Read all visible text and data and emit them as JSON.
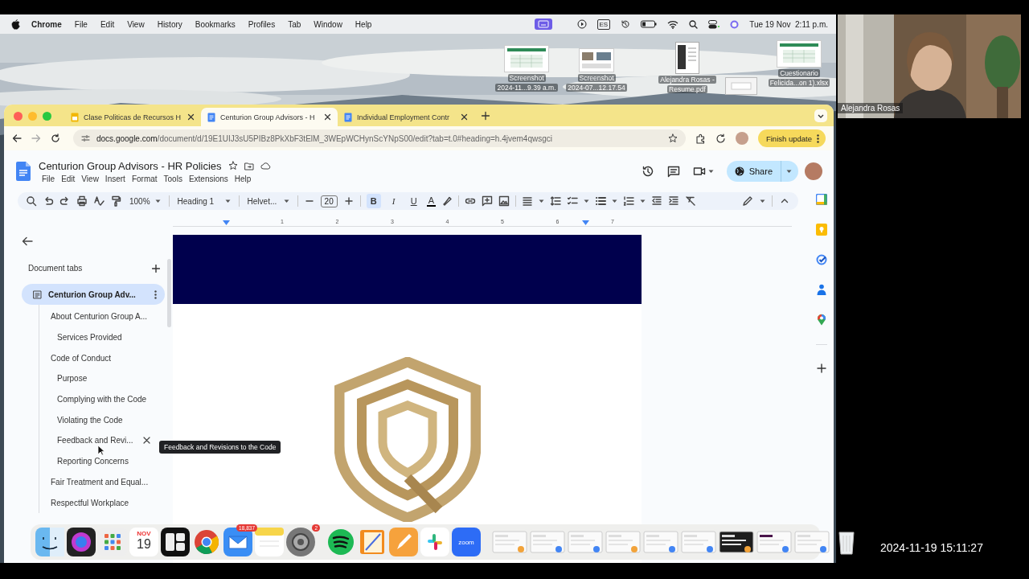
{
  "menubar": {
    "app": "Chrome",
    "menus": [
      "File",
      "Edit",
      "View",
      "History",
      "Bookmarks",
      "Profiles",
      "Tab",
      "Window",
      "Help"
    ],
    "input_source": "ES",
    "clock": "Tue 19 Nov  2:11 p.m."
  },
  "desktop_files": [
    {
      "kind": "sheet",
      "lines": [
        "Screenshot",
        "2024-11...9.39 a.m."
      ]
    },
    {
      "lines": [
        "Screenshot",
        "2024-07...12.17.54"
      ]
    },
    {
      "kind": "doc",
      "lines": [
        "Alejandra Rosas -",
        "Resume.pdf"
      ]
    },
    {
      "kind": "window"
    },
    {
      "kind": "sheet",
      "lines": [
        "Cuestionario",
        "Felicida...on 1).xlsx"
      ]
    }
  ],
  "browser": {
    "tabs": [
      {
        "kind": "sheets",
        "title": "Clase Politicas de Recursos H",
        "selected": false
      },
      {
        "kind": "docs",
        "title": "Centurion Group Advisors - H",
        "selected": true
      },
      {
        "kind": "docs",
        "title": "Individual Employment Contr",
        "selected": false
      }
    ],
    "url_host": "docs.google.com",
    "url_path": "/document/d/19E1UIJ3sU5PIBz8PkXbF3tElM_3WEpWCHynScYNpS00/edit?tab=t.0#heading=h.4jvem4qwsgci",
    "update_button": "Finish update"
  },
  "docs": {
    "title": "Centurion Group Advisors - HR Policies",
    "menus": [
      "File",
      "Edit",
      "View",
      "Insert",
      "Format",
      "Tools",
      "Extensions",
      "Help"
    ],
    "share": "Share",
    "toolbar": {
      "zoom": "100%",
      "style": "Heading 1",
      "font": "Helvet...",
      "size": "20",
      "format": [
        {
          "label": "B",
          "selected": true
        },
        {
          "label": "I",
          "selected": false
        },
        {
          "label": "U",
          "selected": false
        }
      ],
      "text_color": "A"
    },
    "ruler": [
      "1",
      "2",
      "3",
      "4",
      "5",
      "6",
      "7"
    ]
  },
  "outline": {
    "heading": "Document tabs",
    "tab": {
      "title": "Centurion Group Adv...",
      "selected": true
    },
    "items": [
      {
        "label": "About Centurion Group A...",
        "hovered": false,
        "children": [
          {
            "label": "Services Provided",
            "hovered": false
          }
        ]
      },
      {
        "label": "Code of Conduct",
        "hovered": false,
        "children": [
          {
            "label": "Purpose",
            "hovered": false
          },
          {
            "label": "Complying with the Code",
            "hovered": false
          },
          {
            "label": "Violating the Code",
            "hovered": false
          },
          {
            "label": "Feedback and Revi...",
            "hovered": true
          },
          {
            "label": "Reporting Concerns",
            "hovered": false
          }
        ]
      },
      {
        "label": "Fair Treatment and Equal...",
        "hovered": false
      },
      {
        "label": "Respectful Workplace",
        "hovered": false
      }
    ],
    "tooltip": "Feedback and Revisions to the Code"
  },
  "video": {
    "participant": "Alejandra Rosas"
  },
  "dock": {
    "calendar_month": "NOV",
    "calendar_day": "19",
    "mail_badge": "18,837",
    "settings_badge": "2",
    "zoom_label": "zoom"
  },
  "timestamp": "2024-11-19 15:11:27"
}
